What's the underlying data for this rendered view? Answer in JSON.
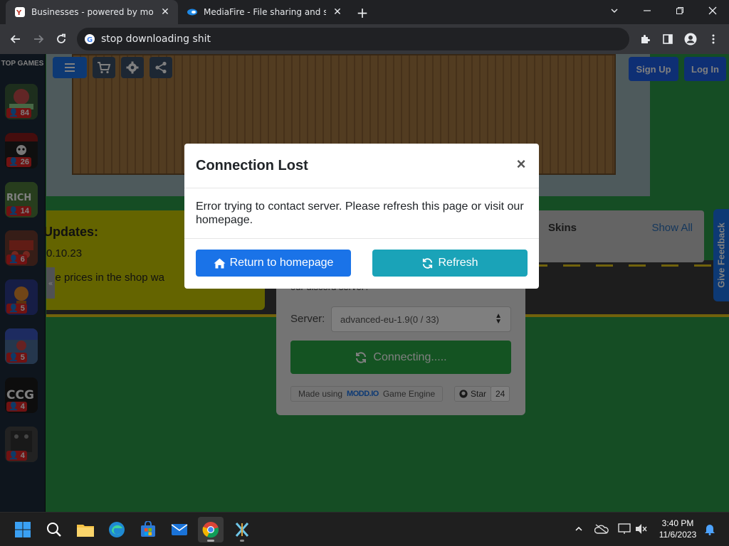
{
  "browser": {
    "tabs": [
      {
        "title": "Businesses - powered by modd.io",
        "active": true
      },
      {
        "title": "MediaFire - File sharing and storage",
        "active": false
      }
    ],
    "address_text": "stop downloading shit"
  },
  "sidebar": {
    "header": "TOP GAMES",
    "games": [
      {
        "count": "84",
        "color": "#3b5d3a"
      },
      {
        "count": "26",
        "color": "#1e1e1e"
      },
      {
        "count": "14",
        "color": "#4f7a3b"
      },
      {
        "count": "6",
        "color": "#6c3b2e"
      },
      {
        "count": "5",
        "color": "#2d3b8a"
      },
      {
        "count": "5",
        "color": "#4b6f9a"
      },
      {
        "count": "4",
        "color": "#1a1a1a"
      },
      {
        "count": "4",
        "color": "#444444"
      }
    ]
  },
  "site_header": {
    "sign_up": "Sign Up",
    "log_in": "Log In"
  },
  "updates": {
    "heading": "Updates:",
    "date": "0.10.23",
    "text": "me prices in the shop wa"
  },
  "skins": {
    "label": "Skins",
    "show_all": "Show All"
  },
  "join": {
    "discord_text": "our discord server?",
    "server_label": "Server:",
    "server_value": "advanced-eu-1.9(0 / 33)",
    "connect_label": "Connecting.....",
    "made_using_prefix": "Made using",
    "engine_logo": "MODD.IO",
    "made_using_suffix": "Game Engine",
    "star_label": "Star",
    "star_count": "24"
  },
  "feedback_label": "Give Feedback",
  "modal": {
    "title": "Connection Lost",
    "message": "Error trying to contact server. Please refresh this page or visit our homepage.",
    "home_button": "Return to homepage",
    "refresh_button": "Refresh"
  },
  "taskbar": {
    "time": "3:40 PM",
    "date": "11/6/2023"
  }
}
